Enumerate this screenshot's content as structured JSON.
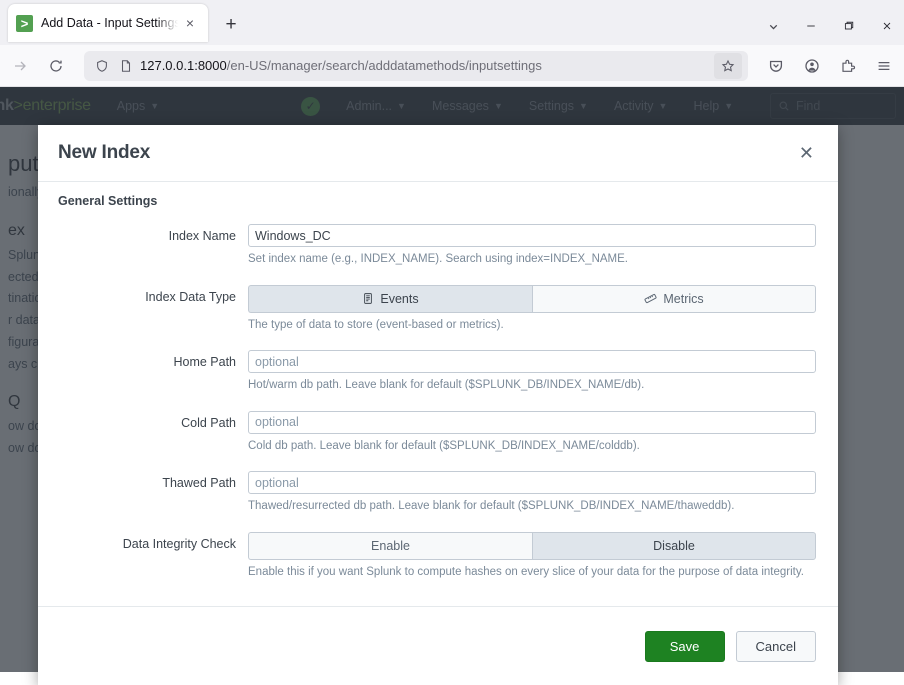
{
  "browser": {
    "tab": {
      "title": "Add Data - Input Settings",
      "favicon": "splunk-favicon",
      "close_label": "×"
    },
    "new_tab_label": "+",
    "tab_list_icon": "chevron-down-icon",
    "window_controls": {
      "minimize": "—",
      "maximize": "❐",
      "close": "✕"
    },
    "nav": {
      "forward_icon": "arrow-forward-icon",
      "reload_icon": "reload-icon",
      "shield_icon": "shield-icon",
      "page_icon": "page-icon",
      "star_icon": "bookmark-star-icon",
      "pocket_icon": "save-to-pocket-icon",
      "account_icon": "account-icon",
      "extensions_icon": "extensions-puzzle-icon",
      "menu_icon": "hamburger-menu-icon"
    },
    "url": {
      "host": "127.0.0.1:8000",
      "path": "/en-US/manager/search/adddatamethods/inputsettings"
    }
  },
  "splunk_nav": {
    "logo_text": "unk",
    "logo_gt": ">",
    "logo_enterprise": "enterprise",
    "status_icon": "green-check-icon",
    "items": [
      {
        "label": "Apps",
        "has_caret": true
      },
      {
        "label": "Admin...",
        "has_caret": true
      },
      {
        "label": "Messages",
        "has_caret": true
      },
      {
        "label": "Settings",
        "has_caret": true
      },
      {
        "label": "Activity",
        "has_caret": true
      },
      {
        "label": "Help",
        "has_caret": true
      }
    ],
    "find_placeholder": "Find",
    "find_icon": "search-icon"
  },
  "background_page": {
    "heading": "put",
    "paragraph": "ionally",
    "subheading": "ex",
    "lines": [
      "Splun",
      "ected i",
      "tinatio",
      "r data.",
      "figurat",
      "ays ch"
    ],
    "faq_heading": "Q",
    "faq_items": [
      "ow do",
      "ow do"
    ]
  },
  "modal": {
    "title": "New Index",
    "close_icon": "close-icon",
    "section_title": "General Settings",
    "fields": [
      {
        "name": "index-name",
        "label": "Index Name",
        "type": "text",
        "value": "Windows_DC",
        "placeholder": "",
        "help": "Set index name (e.g., INDEX_NAME). Search using index=INDEX_NAME."
      },
      {
        "name": "index-data-type",
        "label": "Index Data Type",
        "type": "segmented",
        "options": [
          {
            "label": "Events",
            "icon": "events-icon",
            "selected": true
          },
          {
            "label": "Metrics",
            "icon": "metrics-icon",
            "selected": false
          }
        ],
        "help": "The type of data to store (event-based or metrics)."
      },
      {
        "name": "home-path",
        "label": "Home Path",
        "type": "text",
        "value": "",
        "placeholder": "optional",
        "help": "Hot/warm db path. Leave blank for default ($SPLUNK_DB/INDEX_NAME/db)."
      },
      {
        "name": "cold-path",
        "label": "Cold Path",
        "type": "text",
        "value": "",
        "placeholder": "optional",
        "help": "Cold db path. Leave blank for default ($SPLUNK_DB/INDEX_NAME/colddb)."
      },
      {
        "name": "thawed-path",
        "label": "Thawed Path",
        "type": "text",
        "value": "",
        "placeholder": "optional",
        "help": "Thawed/resurrected db path. Leave blank for default ($SPLUNK_DB/INDEX_NAME/thaweddb)."
      },
      {
        "name": "data-integrity-check",
        "label": "Data Integrity Check",
        "type": "segmented",
        "options": [
          {
            "label": "Enable",
            "icon": "",
            "selected": false
          },
          {
            "label": "Disable",
            "icon": "",
            "selected": true
          }
        ],
        "help": "Enable this if you want Splunk to compute hashes on every slice of your data for the purpose of data integrity."
      }
    ],
    "footer": {
      "save_label": "Save",
      "cancel_label": "Cancel"
    }
  },
  "colors": {
    "splunk_nav_bg": "#31373e",
    "splunk_green": "#53a051",
    "save_green": "#1e8222",
    "overlay": "rgba(47,54,62,0.72)"
  }
}
